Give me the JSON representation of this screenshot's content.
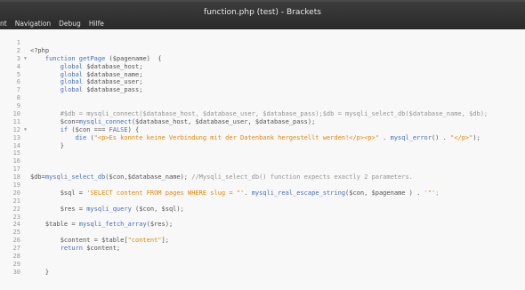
{
  "window": {
    "title": "function.php (test) - Brackets"
  },
  "menu": {
    "items": [
      "nt",
      "Navigation",
      "Debug",
      "Hilfe"
    ]
  },
  "editor": {
    "lines": [
      {
        "num": "1",
        "fold": false,
        "tokens": []
      },
      {
        "num": "2",
        "fold": false,
        "tokens": [
          {
            "t": "<?php",
            "c": "tag"
          }
        ]
      },
      {
        "num": "3",
        "fold": true,
        "tokens": [
          {
            "t": "    function ",
            "c": "kw"
          },
          {
            "t": "getPage",
            "c": "fn"
          },
          {
            "t": " ($pagename)  {",
            "c": "var"
          }
        ]
      },
      {
        "num": "4",
        "fold": false,
        "tokens": [
          {
            "t": "        global ",
            "c": "kw"
          },
          {
            "t": "$database_host;",
            "c": "var"
          }
        ]
      },
      {
        "num": "5",
        "fold": false,
        "tokens": [
          {
            "t": "        global ",
            "c": "kw"
          },
          {
            "t": "$database_name;",
            "c": "var"
          }
        ]
      },
      {
        "num": "6",
        "fold": false,
        "tokens": [
          {
            "t": "        global ",
            "c": "kw"
          },
          {
            "t": "$database_user;",
            "c": "var"
          }
        ]
      },
      {
        "num": "7",
        "fold": false,
        "tokens": [
          {
            "t": "        global ",
            "c": "kw"
          },
          {
            "t": "$database_pass;",
            "c": "var"
          }
        ]
      },
      {
        "num": "8",
        "fold": false,
        "tokens": []
      },
      {
        "num": "9",
        "fold": false,
        "tokens": []
      },
      {
        "num": "10",
        "fold": false,
        "tokens": [
          {
            "t": "        #$db = mysqli_connect($database_host, $database_user, $database_pass);$db = mysqli_select_db($database_name, $db);",
            "c": "com"
          }
        ]
      },
      {
        "num": "11",
        "fold": false,
        "tokens": [
          {
            "t": "        $con=",
            "c": "var"
          },
          {
            "t": "mysqli_connect",
            "c": "fn"
          },
          {
            "t": "($database_host, $database_user, $database_pass);",
            "c": "var"
          }
        ]
      },
      {
        "num": "12",
        "fold": true,
        "tokens": [
          {
            "t": "        if ",
            "c": "kw"
          },
          {
            "t": "($con === ",
            "c": "var"
          },
          {
            "t": "FALSE",
            "c": "kw"
          },
          {
            "t": ") {",
            "c": "var"
          }
        ]
      },
      {
        "num": "13",
        "fold": false,
        "tokens": [
          {
            "t": "            die ",
            "c": "kw"
          },
          {
            "t": "(",
            "c": "var"
          },
          {
            "t": "\"<p>Es konnte keine Verbindung mit der Datenbank hergestellt werden!</p><p>\"",
            "c": "str"
          },
          {
            "t": " . ",
            "c": "var"
          },
          {
            "t": "mysql_error",
            "c": "fn"
          },
          {
            "t": "() . ",
            "c": "var"
          },
          {
            "t": "\"</p>\"",
            "c": "str"
          },
          {
            "t": ");",
            "c": "var"
          }
        ]
      },
      {
        "num": "14",
        "fold": false,
        "tokens": [
          {
            "t": "        }",
            "c": "var"
          }
        ]
      },
      {
        "num": "15",
        "fold": false,
        "tokens": []
      },
      {
        "num": "16",
        "fold": false,
        "tokens": []
      },
      {
        "num": "17",
        "fold": false,
        "tokens": []
      },
      {
        "num": "18",
        "fold": false,
        "tokens": [
          {
            "t": "$db=",
            "c": "var"
          },
          {
            "t": "mysqli_select_db",
            "c": "fn"
          },
          {
            "t": "($con,$database_name); ",
            "c": "var"
          },
          {
            "t": "//Mysqli_select_db() function expects exactly 2 parameters.",
            "c": "com"
          }
        ]
      },
      {
        "num": "19",
        "fold": false,
        "tokens": []
      },
      {
        "num": "20",
        "fold": false,
        "tokens": [
          {
            "t": "        $sql = ",
            "c": "var"
          },
          {
            "t": "'SELECT content FROM pages WHERE slug = \"'",
            "c": "str"
          },
          {
            "t": ". ",
            "c": "var"
          },
          {
            "t": "mysqli_real_escape_string",
            "c": "fn"
          },
          {
            "t": "($con, $pagename ) . ",
            "c": "var"
          },
          {
            "t": "'\"';",
            "c": "str"
          }
        ]
      },
      {
        "num": "21",
        "fold": false,
        "tokens": []
      },
      {
        "num": "22",
        "fold": false,
        "tokens": [
          {
            "t": "        $res = ",
            "c": "var"
          },
          {
            "t": "mysqli_query",
            "c": "fn"
          },
          {
            "t": " ($con, $sql);",
            "c": "var"
          }
        ]
      },
      {
        "num": "23",
        "fold": false,
        "tokens": []
      },
      {
        "num": "24",
        "fold": false,
        "tokens": [
          {
            "t": "    $table = ",
            "c": "var"
          },
          {
            "t": "mysqli_fetch_array",
            "c": "fn"
          },
          {
            "t": "($res);",
            "c": "var"
          }
        ]
      },
      {
        "num": "25",
        "fold": false,
        "tokens": []
      },
      {
        "num": "26",
        "fold": false,
        "tokens": [
          {
            "t": "        $content = $table[",
            "c": "var"
          },
          {
            "t": "\"content\"",
            "c": "str"
          },
          {
            "t": "];",
            "c": "var"
          }
        ]
      },
      {
        "num": "27",
        "fold": false,
        "tokens": [
          {
            "t": "        return ",
            "c": "kw"
          },
          {
            "t": "$content;",
            "c": "var"
          }
        ]
      },
      {
        "num": "28",
        "fold": false,
        "tokens": []
      },
      {
        "num": "29",
        "fold": false,
        "tokens": []
      },
      {
        "num": "30",
        "fold": false,
        "tokens": [
          {
            "t": "    }",
            "c": "var"
          }
        ]
      }
    ]
  }
}
